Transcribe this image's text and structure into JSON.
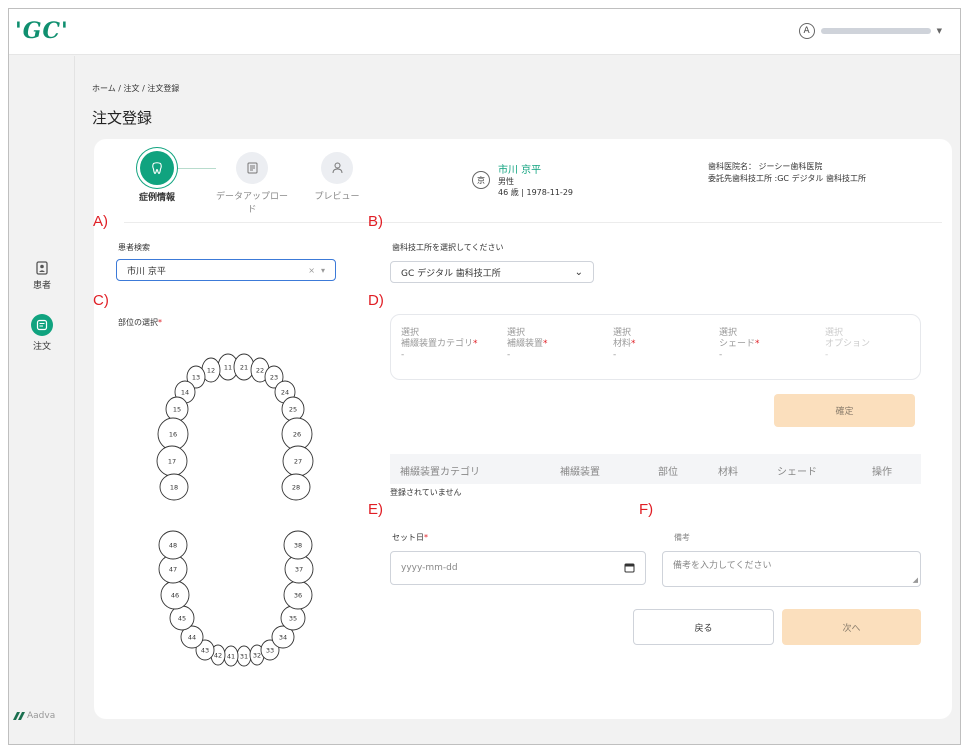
{
  "header": {
    "logo": "'GC'",
    "avatar_letter": "A"
  },
  "sidebar": {
    "items": [
      {
        "label": "患者",
        "icon": "patient-icon"
      },
      {
        "label": "注文",
        "icon": "order-icon"
      }
    ],
    "footer_logo": "Aadva"
  },
  "breadcrumb": "ホーム / 注文 / 注文登録",
  "page_title": "注文登録",
  "steps": [
    {
      "label": "症例情報",
      "icon": "tooth-icon",
      "active": true
    },
    {
      "label": "データアップロード",
      "icon": "document-icon",
      "active": false
    },
    {
      "label": "プレビュー",
      "icon": "person-icon",
      "active": false
    }
  ],
  "patient": {
    "badge": "京",
    "name": "市川 京平",
    "gender": "男性",
    "age_birth": "46 歳 | 1978-11-29"
  },
  "clinic": {
    "clinic_line": "歯科医院名： ジーシー歯科医院",
    "lab_line": "委託先歯科技工所 :GC デジタル 歯科技工所"
  },
  "sections": {
    "a": "A)",
    "b": "B)",
    "c": "C)",
    "d": "D)",
    "e": "E)",
    "f": "F)"
  },
  "patient_search": {
    "label": "患者検索",
    "value": "市川 京平",
    "clear": "×",
    "caret": "▾"
  },
  "lab_select": {
    "label": "歯科技工所を選択してください",
    "value": "GC デジタル 歯科技工所",
    "caret": "⌄"
  },
  "site_select": {
    "label": "部位の選択",
    "required_mark": "*"
  },
  "options": [
    {
      "select": "選択",
      "label": "補綴装置カテゴリ",
      "required": "*",
      "value": "-",
      "disabled": false
    },
    {
      "select": "選択",
      "label": "補綴装置",
      "required": "*",
      "value": "-",
      "disabled": false
    },
    {
      "select": "選択",
      "label": "材料",
      "required": "*",
      "value": "-",
      "disabled": false
    },
    {
      "select": "選択",
      "label": "シェード",
      "required": "*",
      "value": "-",
      "disabled": false
    },
    {
      "select": "選択",
      "label": "オプション",
      "required": "",
      "value": "-",
      "disabled": true
    }
  ],
  "confirm_button": "確定",
  "table": {
    "headers": [
      "補綴装置カテゴリ",
      "補綴装置",
      "部位",
      "材料",
      "シェード",
      "操作"
    ],
    "empty_text": "登録されていません"
  },
  "set_date": {
    "label": "セット日",
    "required_mark": "*",
    "placeholder": "yyyy-mm-dd"
  },
  "remarks": {
    "label": "備考",
    "placeholder": "備考を入力してください"
  },
  "buttons": {
    "back": "戻る",
    "next": "次へ"
  },
  "teeth": {
    "upper": [
      "11",
      "12",
      "13",
      "14",
      "15",
      "16",
      "17",
      "18",
      "21",
      "22",
      "23",
      "24",
      "25",
      "26",
      "27",
      "28"
    ],
    "lower": [
      "31",
      "32",
      "33",
      "34",
      "35",
      "36",
      "37",
      "38",
      "41",
      "42",
      "43",
      "44",
      "45",
      "46",
      "47",
      "48"
    ]
  },
  "colors": {
    "accent": "#10a37f",
    "required": "#e01e25",
    "button_disabled": "#fbdfbd"
  }
}
